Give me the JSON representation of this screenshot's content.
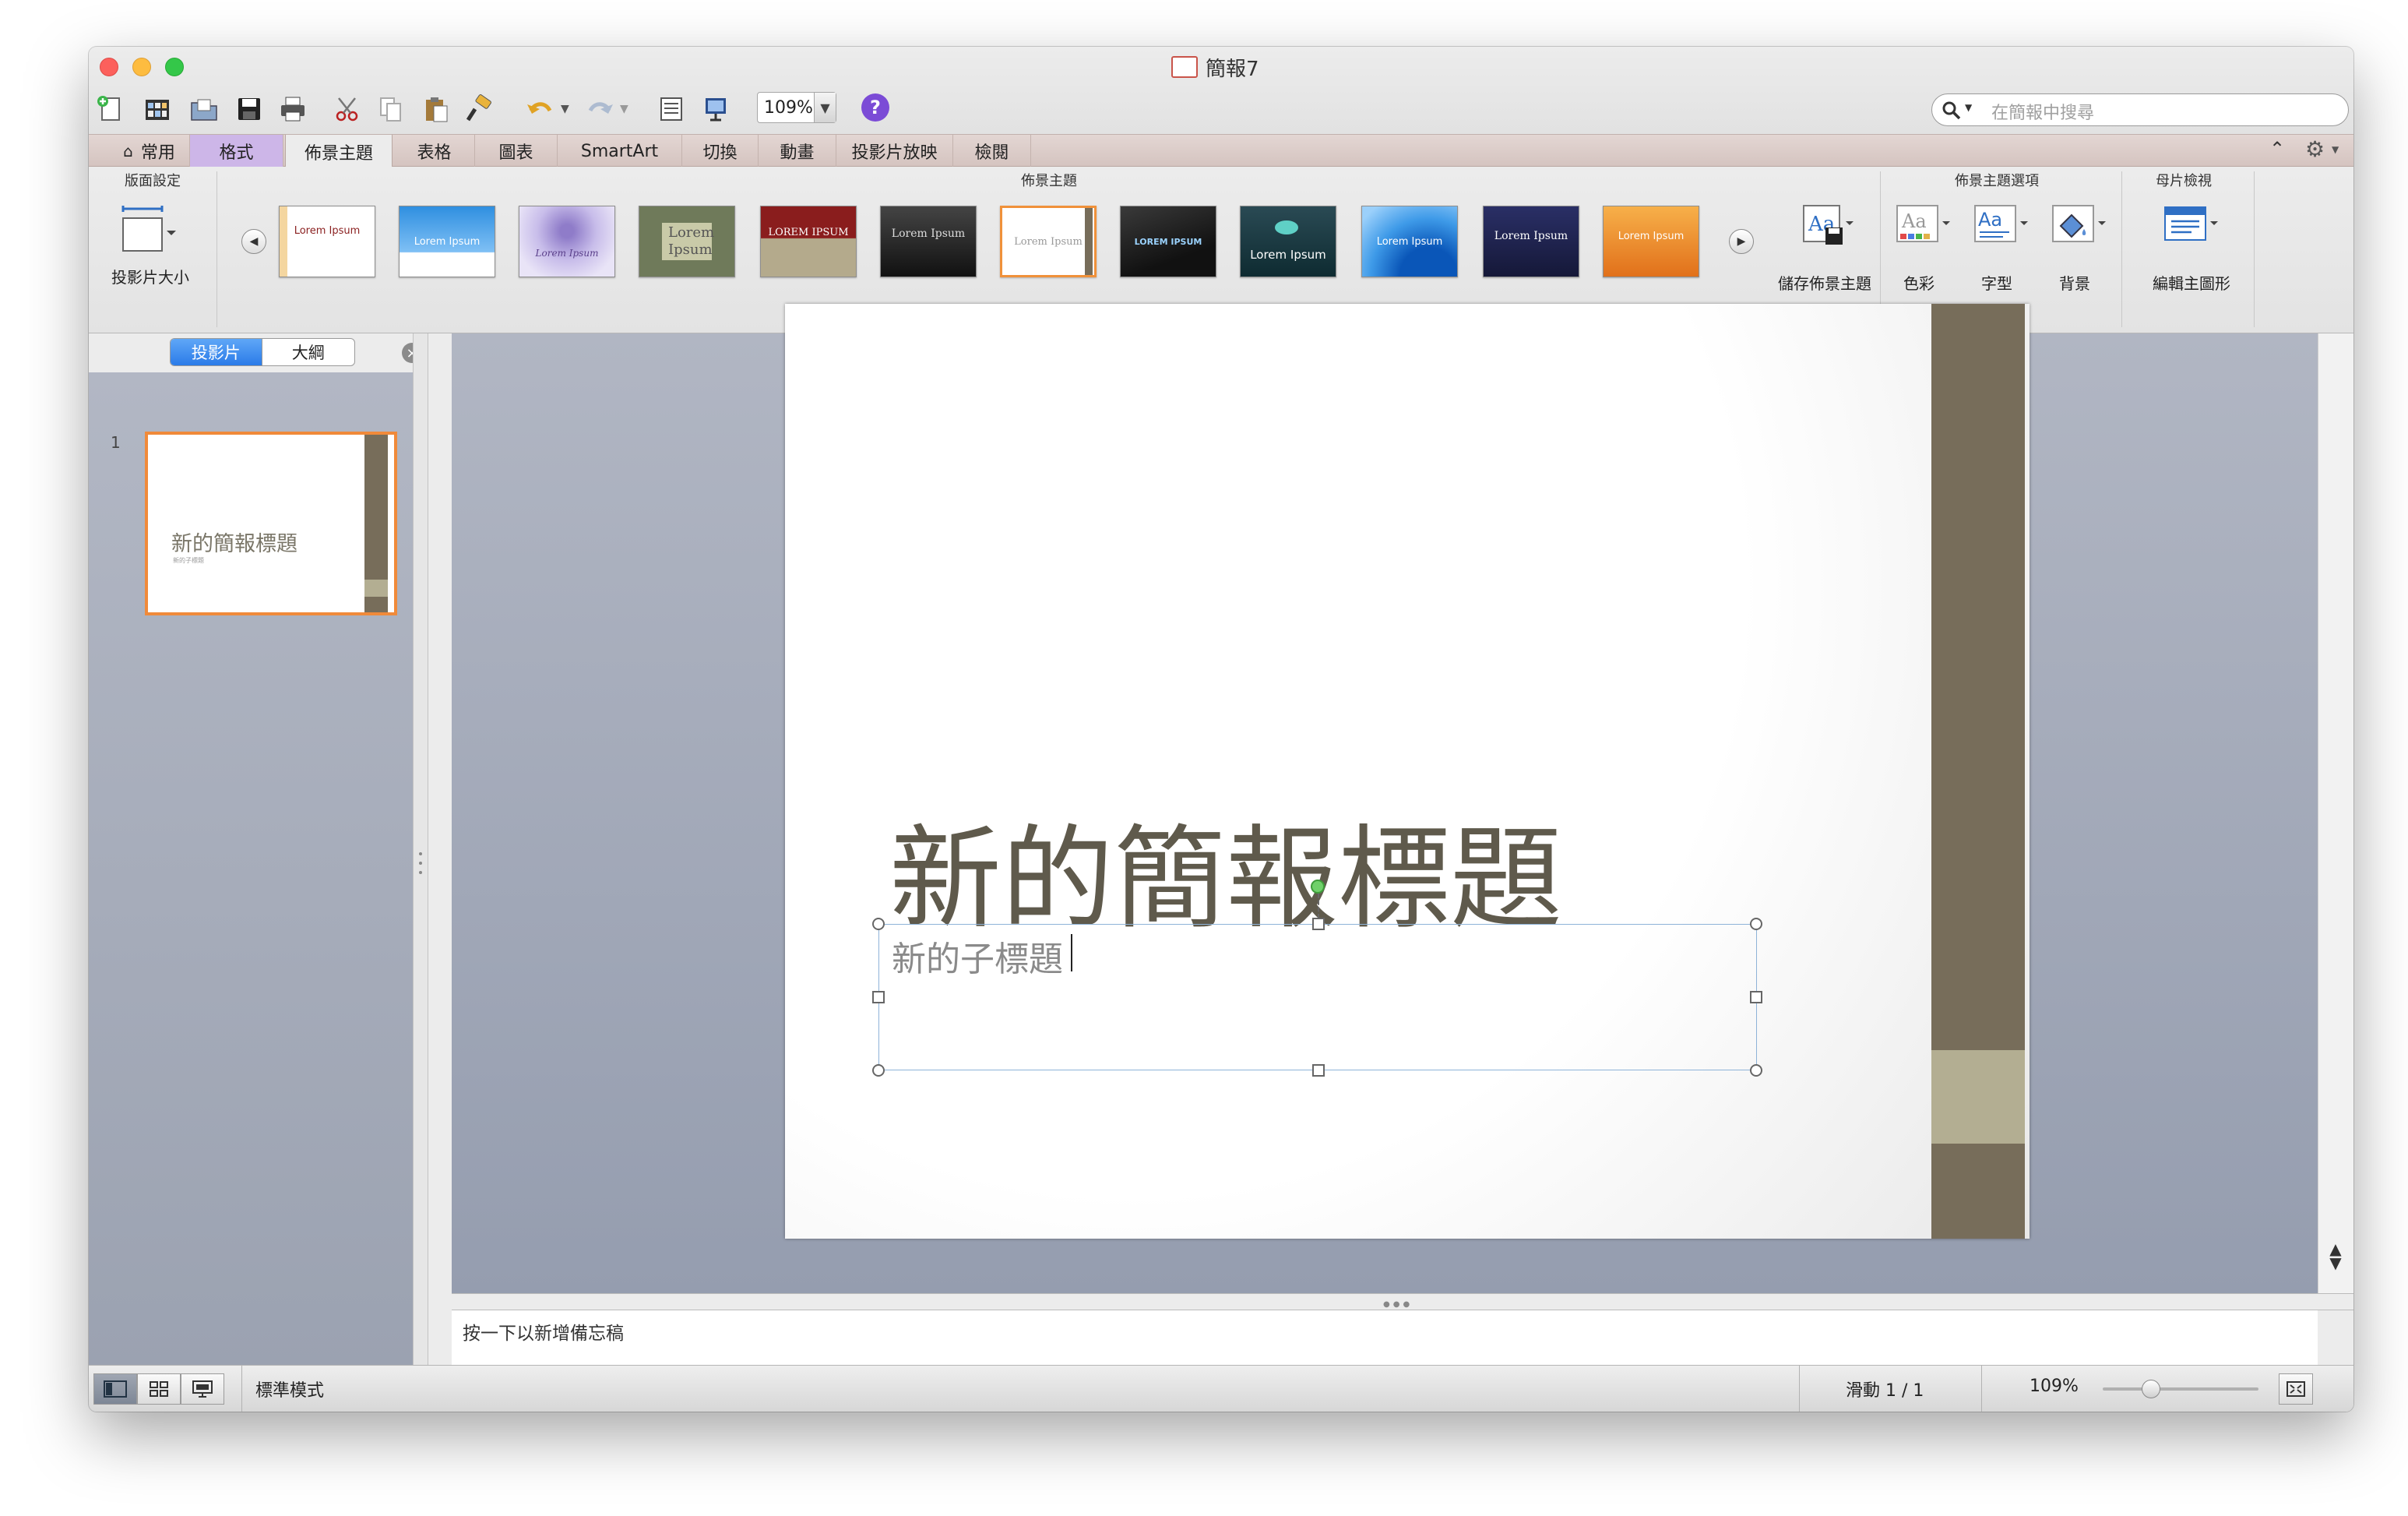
{
  "window": {
    "title": "簡報7"
  },
  "toolbar": {
    "zoom_value": "109%",
    "help_label": "?",
    "search_placeholder": "在簡報中搜尋"
  },
  "tabs": [
    {
      "label": "常用",
      "icon": "home-icon"
    },
    {
      "label": "格式"
    },
    {
      "label": "佈景主題",
      "active": true
    },
    {
      "label": "表格"
    },
    {
      "label": "圖表"
    },
    {
      "label": "SmartArt"
    },
    {
      "label": "切換"
    },
    {
      "label": "動畫"
    },
    {
      "label": "投影片放映"
    },
    {
      "label": "檢閱"
    }
  ],
  "ribbon": {
    "page_setup": {
      "group_label": "版面設定",
      "slide_size_label": "投影片大小"
    },
    "themes": {
      "group_label": "佈景主題",
      "items": [
        "Lorem Ipsum",
        "Lorem Ipsum",
        "Lorem Ipsum",
        "Lorem Ipsum",
        "LOREM IPSUM",
        "Lorem Ipsum",
        "Lorem Ipsum",
        "LOREM IPSUM",
        "Lorem Ipsum",
        "Lorem Ipsum",
        "Lorem Ipsum",
        "Lorem Ipsum"
      ],
      "save_theme_label": "儲存佈景主題"
    },
    "theme_options": {
      "group_label": "佈景主題選項",
      "colors_label": "色彩",
      "fonts_label": "字型",
      "background_label": "背景"
    },
    "master_view": {
      "group_label": "母片檢視",
      "edit_master_label": "編輯主圖形"
    }
  },
  "left_pane": {
    "tab_slides": "投影片",
    "tab_outline": "大綱",
    "slide_number": "1",
    "thumb_title": "新的簡報標題",
    "thumb_subtitle": "新的子標題"
  },
  "slide": {
    "title": "新的簡報標題",
    "subtitle": "新的子標題"
  },
  "notes": {
    "placeholder": "按一下以新增備忘稿"
  },
  "statusbar": {
    "view_mode": "標準模式",
    "slide_count": "滑動 1 / 1",
    "zoom": "109%"
  },
  "colors": {
    "accent_orange": "#f08a3a",
    "theme_bar": "#776d5a",
    "theme_bar_light": "#b3ae92",
    "tab_format": "#cdb6e8"
  }
}
